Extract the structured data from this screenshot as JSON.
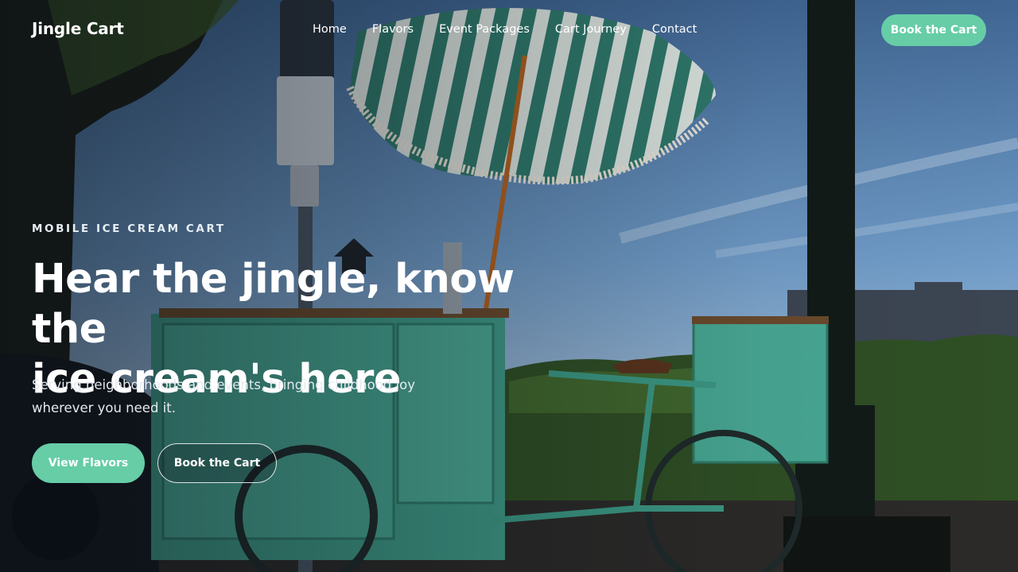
{
  "header": {
    "logo": "Jingle Cart",
    "nav": [
      "Home",
      "Flavors",
      "Event Packages",
      "Cart Journey",
      "Contact"
    ],
    "cta": "Book the Cart"
  },
  "hero": {
    "eyebrow": "MOBILE ICE CREAM CART",
    "headline_line1": "Hear the jingle, know the",
    "headline_line2": "ice cream's here",
    "subtitle": "Serving neighborhoods and events, bringing childhood joy wherever you need it.",
    "primary_button": "View Flavors",
    "secondary_button": "Book the Cart"
  },
  "colors": {
    "accent": "#66cda7",
    "cart": "#4aa58e",
    "sky": "#6f9bc7"
  },
  "icons": []
}
